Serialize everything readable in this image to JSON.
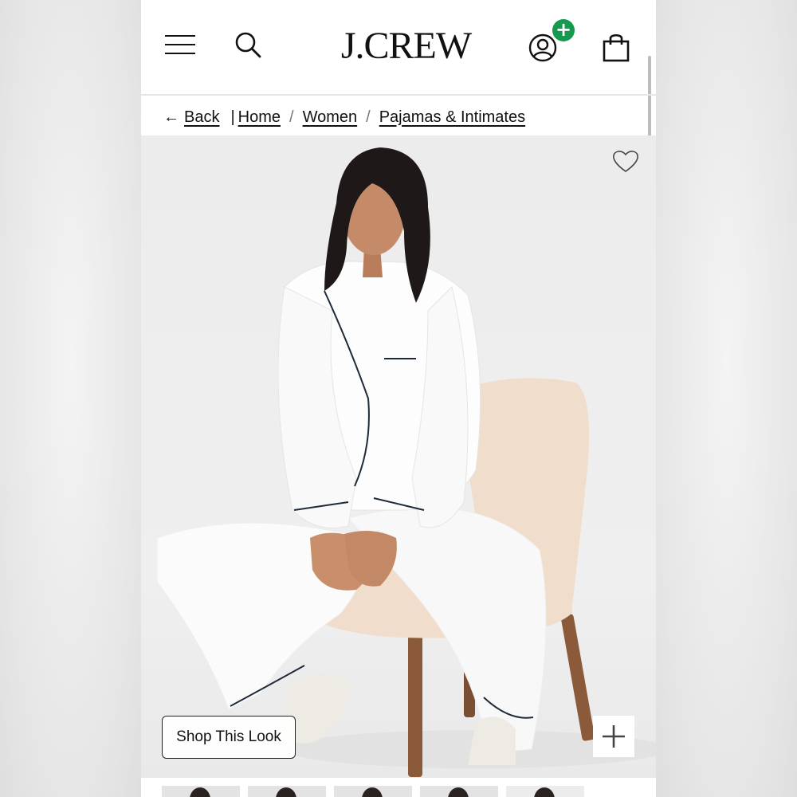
{
  "header": {
    "brand": "J.CREW",
    "account_badge": "+"
  },
  "breadcrumb": {
    "back_label": "Back",
    "items": [
      {
        "label": "Home"
      },
      {
        "label": "Women"
      },
      {
        "label": "Pajamas & Intimates"
      }
    ]
  },
  "product": {
    "shop_look_label": "Shop This Look"
  },
  "colors": {
    "badge_green": "#139a4e",
    "text": "#111111",
    "chair": "#f1ddcc",
    "pajama": "#fbfbfb",
    "piping": "#1e2a3a",
    "wood": "#8a5a3a"
  },
  "icons": [
    "hamburger-menu-icon",
    "search-icon",
    "account-icon",
    "plus-icon",
    "shopping-bag-icon",
    "back-arrow-icon",
    "heart-icon",
    "expand-plus-icon"
  ]
}
